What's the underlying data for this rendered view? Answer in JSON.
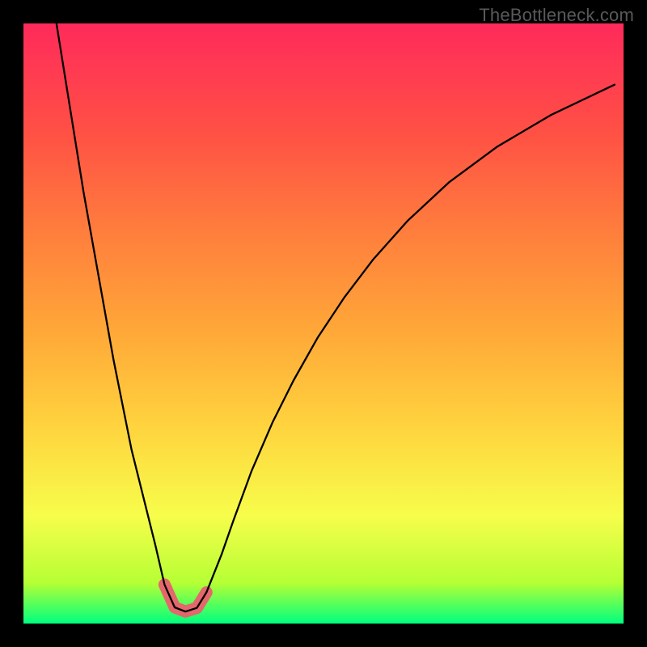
{
  "watermark": "TheBottleneck.com",
  "chart_data": {
    "type": "line",
    "title": "",
    "xlabel": "",
    "ylabel": "",
    "xlim": [
      0,
      100
    ],
    "ylim": [
      0,
      100
    ],
    "series": [
      {
        "name": "curve",
        "x": [
          5.5,
          10,
          15,
          18,
          20,
          22,
          23.5,
          25.2,
          27,
          28.9,
          30.5,
          33,
          35,
          38,
          41.5,
          45,
          49,
          53.5,
          58.3,
          64,
          71,
          79,
          88,
          98.5
        ],
        "values": [
          100,
          72,
          44,
          29,
          21,
          13,
          6.5,
          2.7,
          2,
          2.6,
          5.2,
          11.5,
          17.2,
          25.4,
          33.5,
          40.5,
          47.6,
          54.4,
          60.7,
          67.1,
          73.6,
          79.5,
          84.8,
          89.8
        ]
      },
      {
        "name": "dip-highlight",
        "x": [
          23.5,
          25.2,
          27,
          28.9,
          30.5
        ],
        "values": [
          6.5,
          2.7,
          2,
          2.6,
          5.2
        ]
      }
    ],
    "note": "values are vertical positions in percent of plot height; axes are unlabeled in source image."
  }
}
